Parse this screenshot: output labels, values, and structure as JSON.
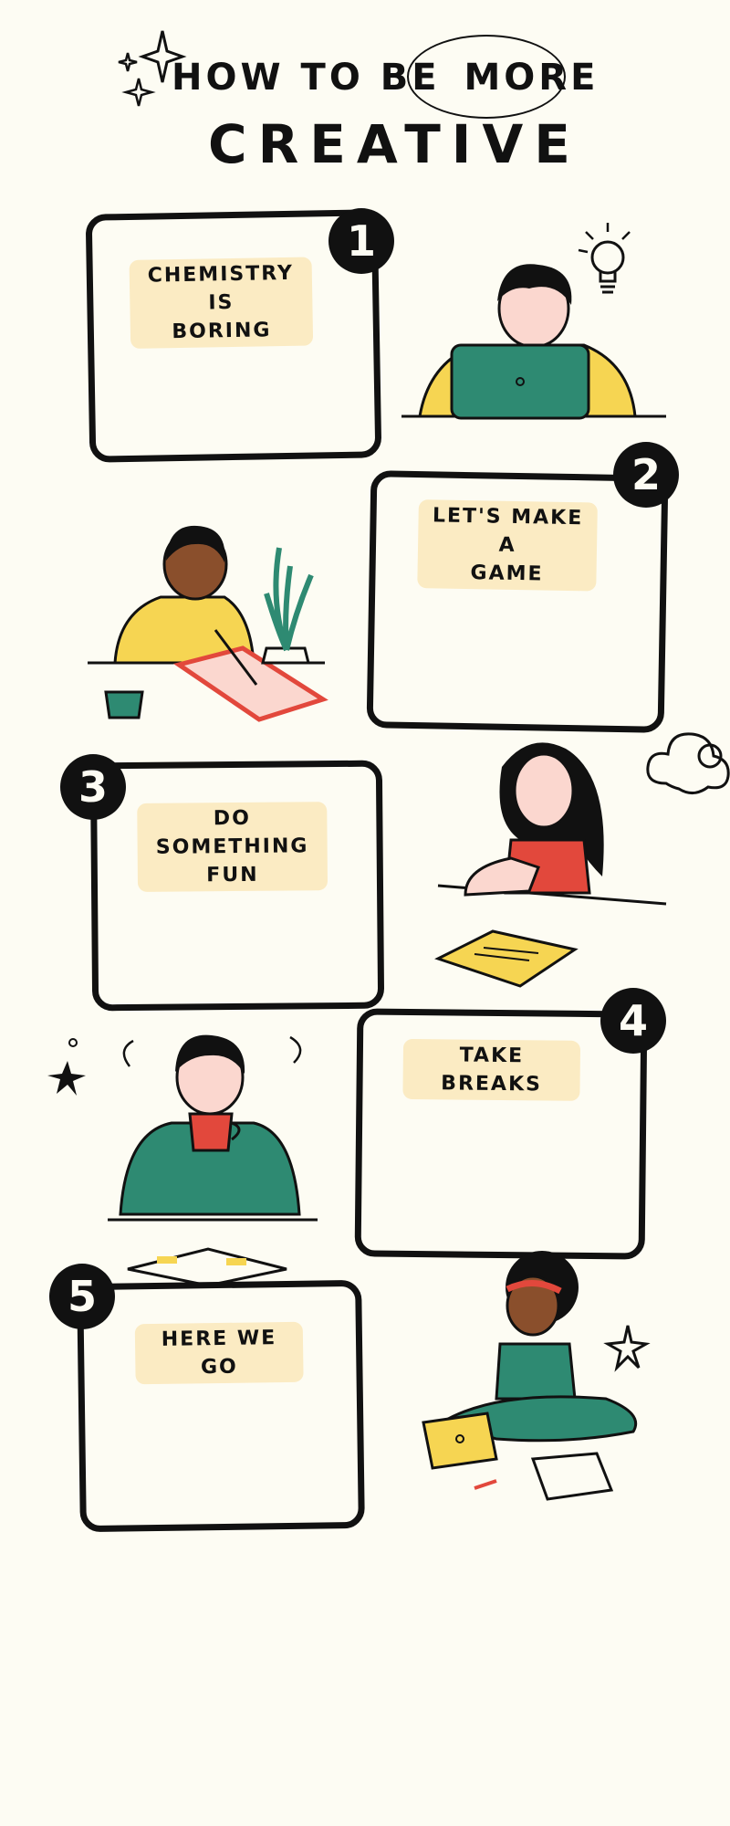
{
  "title": {
    "line1_a": "HOW TO BE",
    "line1_b": "MORE",
    "line2": "CREATIVE"
  },
  "steps": [
    {
      "number": "1",
      "label_line1": "CHEMISTRY IS",
      "label_line2": "BORING"
    },
    {
      "number": "2",
      "label_line1": "LET'S MAKE A",
      "label_line2": "GAME"
    },
    {
      "number": "3",
      "label_line1": "DO SOMETHING",
      "label_line2": "FUN"
    },
    {
      "number": "4",
      "label_line1": "TAKE BREAKS",
      "label_line2": ""
    },
    {
      "number": "5",
      "label_line1": "HERE WE GO",
      "label_line2": ""
    }
  ],
  "colors": {
    "background": "#fdfcf3",
    "ink": "#111111",
    "label_highlight": "#fbebc3",
    "yellow": "#f6d552",
    "green": "#2e8a72",
    "red": "#e2483c",
    "skin_light": "#fbd7cf",
    "skin_dark": "#8a4f2c"
  },
  "icons": [
    "sparkle-icon",
    "lightbulb-icon",
    "cloud-doodle-icon",
    "star-doodle-icon"
  ]
}
